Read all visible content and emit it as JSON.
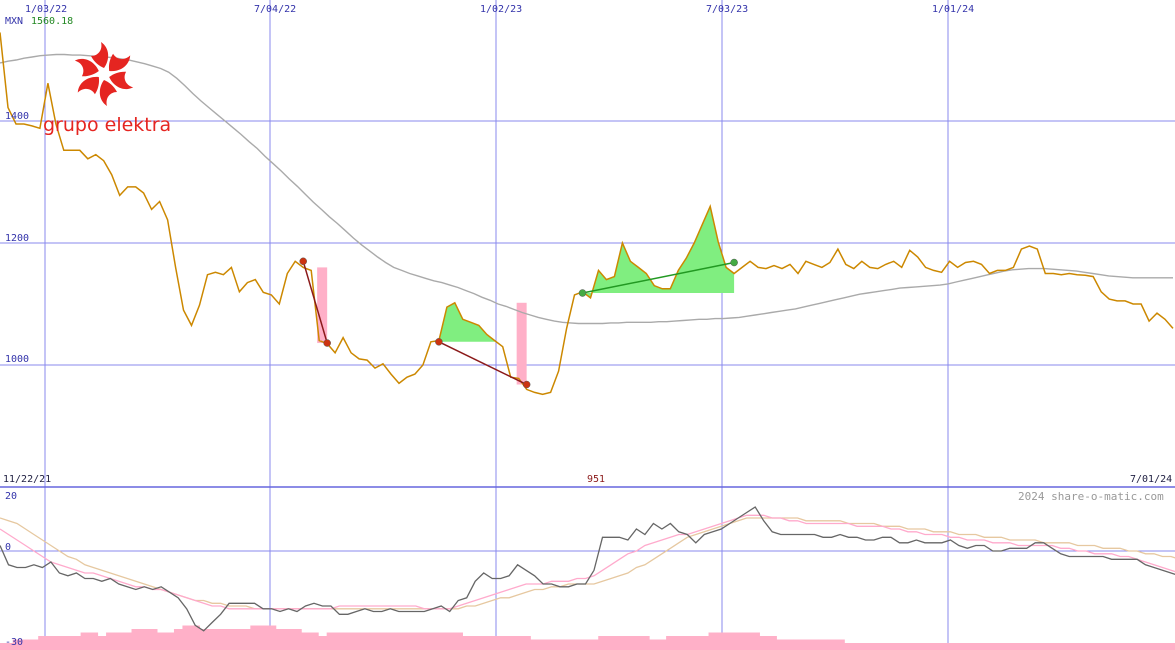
{
  "header": {
    "currency": "MXN",
    "last_price": "1560.18",
    "currency_color": "#3333aa",
    "price_color": "#228822"
  },
  "logo": {
    "text": "grupo elektra",
    "color": "#e52521"
  },
  "footer": {
    "start_date": "11/22/21",
    "end_date": "7/01/24",
    "low_marker": "951",
    "copyright": "2024 share-o-matic.com"
  },
  "chart_data": [
    {
      "type": "line",
      "title": "",
      "x_tick_labels": [
        "1/03/22",
        "7/04/22",
        "1/02/23",
        "7/03/23",
        "1/01/24"
      ],
      "y_tick_labels": [
        "1400",
        "1200",
        "1000"
      ],
      "ylim": [
        830,
        1560
      ],
      "grid": true,
      "series": [
        {
          "role": "price",
          "color": "#cc8800",
          "x": [
            0,
            1,
            2,
            3,
            4,
            5,
            6,
            7,
            8,
            9,
            10,
            11,
            12,
            13,
            14,
            15,
            16,
            17,
            18,
            19,
            20,
            21,
            22,
            23,
            24,
            25,
            26,
            27,
            28,
            29,
            30,
            31,
            32,
            33,
            34,
            35,
            36,
            37,
            38,
            39,
            40,
            41,
            42,
            43,
            44,
            45,
            46,
            47,
            48,
            49,
            50,
            51,
            52,
            53,
            54,
            55,
            56,
            57,
            58,
            59,
            60,
            61,
            62,
            63,
            64,
            65,
            66,
            67,
            68,
            69,
            70,
            71,
            72,
            73,
            74,
            75,
            76,
            77,
            78,
            79,
            80,
            81,
            82,
            83,
            84,
            85,
            86,
            87,
            88,
            89,
            90,
            91,
            92,
            93,
            94,
            95,
            96,
            97,
            98,
            99,
            100,
            101,
            102,
            103,
            104,
            105,
            106,
            107,
            108,
            109,
            110,
            111,
            112,
            113,
            114,
            115,
            116,
            117,
            118,
            119,
            120,
            121,
            122,
            123,
            124,
            125,
            126,
            127,
            128,
            129,
            130,
            131,
            132,
            133,
            134,
            135,
            136,
            137
          ],
          "values": [
            1545,
            1422,
            1395,
            1395,
            1392,
            1388,
            1462,
            1395,
            1352,
            1352,
            1352,
            1338,
            1345,
            1335,
            1312,
            1278,
            1292,
            1292,
            1282,
            1255,
            1268,
            1238,
            1160,
            1090,
            1065,
            1098,
            1148,
            1152,
            1148,
            1160,
            1120,
            1135,
            1140,
            1119,
            1115,
            1100,
            1150,
            1170,
            1160,
            1155,
            1040,
            1035,
            1020,
            1045,
            1020,
            1010,
            1008,
            995,
            1002,
            985,
            970,
            980,
            985,
            1000,
            1038,
            1040,
            1095,
            1102,
            1075,
            1070,
            1065,
            1050,
            1040,
            1030,
            980,
            978,
            960,
            955,
            952,
            955,
            990,
            1060,
            1115,
            1120,
            1110,
            1155,
            1140,
            1145,
            1200,
            1170,
            1160,
            1150,
            1130,
            1125,
            1125,
            1155,
            1175,
            1200,
            1230,
            1260,
            1202,
            1160,
            1150,
            1160,
            1170,
            1160,
            1158,
            1163,
            1158,
            1165,
            1150,
            1170,
            1165,
            1160,
            1168,
            1190,
            1165,
            1158,
            1170,
            1160,
            1158,
            1165,
            1170,
            1160,
            1188,
            1177,
            1160,
            1155,
            1152,
            1170,
            1160,
            1168,
            1170,
            1165,
            1150,
            1155,
            1155,
            1160,
            1190,
            1195,
            1190,
            1150,
            1150,
            1148,
            1150,
            1148,
            1147,
            1145
          ],
          "extra": [
            1120,
            1108,
            1105,
            1105,
            1100,
            1100,
            1072,
            1085,
            1075,
            1060
          ]
        },
        {
          "role": "moving-average",
          "color": "#aaaaaa",
          "values": [
            1495,
            1498,
            1500,
            1503,
            1505,
            1507,
            1508,
            1509,
            1509,
            1508,
            1508,
            1507,
            1506,
            1505,
            1504,
            1502,
            1500,
            1497,
            1494,
            1490,
            1486,
            1480,
            1470,
            1458,
            1445,
            1433,
            1422,
            1411,
            1400,
            1389,
            1378,
            1366,
            1355,
            1342,
            1330,
            1318,
            1305,
            1293,
            1280,
            1267,
            1255,
            1243,
            1232,
            1220,
            1208,
            1197,
            1187,
            1177,
            1168,
            1160,
            1155,
            1150,
            1146,
            1142,
            1138,
            1135,
            1131,
            1127,
            1122,
            1117,
            1111,
            1106,
            1100,
            1096,
            1091,
            1086,
            1082,
            1078,
            1075,
            1072,
            1070,
            1069,
            1068,
            1068,
            1068,
            1068,
            1069,
            1069,
            1070,
            1070,
            1070,
            1070,
            1071,
            1071,
            1072,
            1073,
            1074,
            1075,
            1075,
            1076,
            1076,
            1077,
            1078,
            1080,
            1082,
            1084,
            1086,
            1088,
            1090,
            1092,
            1095,
            1098,
            1101,
            1104,
            1107,
            1110,
            1113,
            1116,
            1118,
            1120,
            1122,
            1124,
            1126,
            1127,
            1128,
            1129,
            1130,
            1131,
            1133,
            1136,
            1139,
            1142,
            1145,
            1148,
            1151,
            1154,
            1156,
            1157,
            1158,
            1158,
            1158,
            1157,
            1156,
            1155,
            1154,
            1152,
            1150,
            1148,
            1146,
            1145,
            1144,
            1143,
            1143,
            1143,
            1143,
            1143,
            1143
          ]
        }
      ],
      "trend_markers": [
        {
          "kind": "down",
          "from": [
            38,
            1170
          ],
          "to": [
            41,
            1036
          ],
          "box_color": "#ffb0c8",
          "line_color": "#8b1a1a",
          "dot_color": "#cc3311"
        },
        {
          "kind": "down",
          "from": [
            55,
            1038
          ],
          "to": [
            66,
            968
          ],
          "box_color": "#ffb0c8",
          "line_color": "#8b1a1a",
          "dot_color": "#cc3311"
        },
        {
          "kind": "up",
          "from": [
            73,
            1118
          ],
          "to": [
            92,
            1168
          ],
          "box_color": "#80ee80",
          "line_color": "#229922",
          "dot_color": "#44aa44"
        }
      ]
    },
    {
      "type": "line",
      "title": "",
      "y_tick_labels": [
        "20",
        "0",
        "-30"
      ],
      "ylim": [
        -30,
        20
      ],
      "grid": true,
      "series": [
        {
          "role": "oscillator",
          "color": "#666666",
          "values": [
            2,
            -5,
            -6,
            -6,
            -5,
            -6,
            -4,
            -8,
            -9,
            -8,
            -10,
            -10,
            -11,
            -10,
            -12,
            -13,
            -14,
            -13,
            -14,
            -13,
            -15,
            -17,
            -21,
            -27,
            -29,
            -26,
            -23,
            -19,
            -19,
            -19,
            -19,
            -21,
            -21,
            -22,
            -21,
            -22,
            -20,
            -19,
            -20,
            -20,
            -23,
            -23,
            -22,
            -21,
            -22,
            -22,
            -21,
            -22,
            -22,
            -22,
            -22,
            -21,
            -20,
            -22,
            -18,
            -17,
            -11,
            -8,
            -10,
            -10,
            -9,
            -5,
            -7,
            -9,
            -12,
            -12,
            -13,
            -13,
            -12,
            -12,
            -7,
            5,
            5,
            5,
            4,
            8,
            6,
            10,
            8,
            10,
            7,
            6,
            3,
            6,
            7,
            8,
            10,
            12,
            14,
            16,
            11,
            7,
            6,
            6,
            6,
            6,
            6,
            5,
            5,
            6,
            5,
            5,
            4,
            4,
            5,
            5,
            3,
            3,
            4,
            3,
            3,
            3,
            4,
            2,
            1,
            2,
            2,
            0,
            0,
            1,
            1,
            1,
            3,
            3,
            1,
            -1,
            -2,
            -2,
            -2,
            -2,
            -2,
            -3,
            -3,
            -3,
            -3,
            -5,
            -6,
            -7,
            -8,
            -9,
            -11
          ]
        },
        {
          "role": "signal-fast",
          "color": "#ffaacc",
          "values": [
            8,
            6,
            4,
            2,
            0,
            -2,
            -4,
            -5,
            -6,
            -7,
            -8,
            -8,
            -9,
            -10,
            -11,
            -12,
            -13,
            -13,
            -14,
            -14,
            -15,
            -16,
            -17,
            -18,
            -19,
            -20,
            -20,
            -21,
            -21,
            -21,
            -21,
            -21,
            -21,
            -21,
            -21,
            -21,
            -21,
            -21,
            -21,
            -21,
            -20,
            -20,
            -20,
            -20,
            -20,
            -20,
            -20,
            -20,
            -20,
            -20,
            -21,
            -21,
            -21,
            -21,
            -20,
            -19,
            -18,
            -17,
            -16,
            -15,
            -14,
            -13,
            -12,
            -12,
            -12,
            -11,
            -11,
            -11,
            -10,
            -10,
            -9,
            -7,
            -5,
            -3,
            -1,
            0,
            2,
            3,
            4,
            5,
            6,
            6,
            7,
            8,
            9,
            10,
            11,
            12,
            13,
            13,
            13,
            12,
            12,
            11,
            11,
            10,
            10,
            10,
            10,
            10,
            10,
            9,
            9,
            9,
            9,
            8,
            8,
            7,
            7,
            6,
            6,
            6,
            5,
            5,
            4,
            4,
            4,
            3,
            3,
            3,
            2,
            2,
            2,
            2,
            2,
            1,
            1,
            0,
            0,
            -1,
            -1,
            -1,
            -2,
            -2,
            -3,
            -4,
            -5,
            -6,
            -7,
            -8
          ]
        },
        {
          "role": "signal-slow",
          "color": "#e6c8a0",
          "values": [
            12,
            11,
            10,
            8,
            6,
            4,
            2,
            0,
            -2,
            -3,
            -5,
            -6,
            -7,
            -8,
            -9,
            -10,
            -11,
            -12,
            -13,
            -14,
            -15,
            -16,
            -17,
            -18,
            -18,
            -19,
            -19,
            -20,
            -20,
            -20,
            -21,
            -21,
            -21,
            -21,
            -21,
            -21,
            -21,
            -21,
            -21,
            -21,
            -21,
            -21,
            -21,
            -21,
            -21,
            -21,
            -21,
            -21,
            -21,
            -21,
            -21,
            -21,
            -21,
            -21,
            -21,
            -20,
            -20,
            -19,
            -18,
            -17,
            -17,
            -16,
            -15,
            -14,
            -14,
            -13,
            -13,
            -12,
            -12,
            -12,
            -12,
            -11,
            -10,
            -9,
            -8,
            -6,
            -5,
            -3,
            -1,
            1,
            3,
            5,
            6,
            7,
            8,
            9,
            10,
            11,
            12,
            12,
            12,
            12,
            12,
            12,
            12,
            11,
            11,
            11,
            11,
            11,
            10,
            10,
            10,
            10,
            9,
            9,
            9,
            8,
            8,
            8,
            7,
            7,
            7,
            6,
            6,
            6,
            5,
            5,
            5,
            4,
            4,
            4,
            4,
            3,
            3,
            3,
            3,
            2,
            2,
            2,
            1,
            1,
            1,
            0,
            0,
            -1,
            -1,
            -2,
            -2,
            -3,
            -4,
            -4
          ]
        }
      ]
    },
    {
      "type": "bar",
      "title": "",
      "role": "volume",
      "color": "#ffb0c8",
      "values": [
        2,
        2,
        3,
        3,
        3,
        4,
        4,
        4,
        4,
        4,
        5,
        5,
        4,
        5,
        5,
        5,
        6,
        6,
        6,
        5,
        5,
        6,
        7,
        7,
        6,
        6,
        6,
        6,
        6,
        6,
        7,
        7,
        7,
        6,
        6,
        6,
        5,
        5,
        4,
        5,
        5,
        5,
        5,
        5,
        5,
        5,
        5,
        5,
        5,
        5,
        5,
        5,
        5,
        5,
        5,
        4,
        4,
        4,
        4,
        4,
        4,
        4,
        4,
        3,
        3,
        3,
        3,
        3,
        3,
        3,
        3,
        4,
        4,
        4,
        4,
        4,
        4,
        3,
        3,
        4,
        4,
        4,
        4,
        4,
        5,
        5,
        5,
        5,
        5,
        5,
        4,
        4,
        3,
        3,
        3,
        3,
        3,
        3,
        3,
        3,
        2,
        2,
        2,
        2,
        2,
        2,
        2,
        2,
        2,
        2,
        2,
        2,
        2,
        2,
        2,
        2,
        2,
        2,
        2,
        2,
        2,
        2,
        2,
        2,
        2,
        2,
        2,
        2,
        2,
        2,
        2,
        2,
        2,
        2,
        2,
        2,
        2,
        2,
        2
      ]
    }
  ]
}
